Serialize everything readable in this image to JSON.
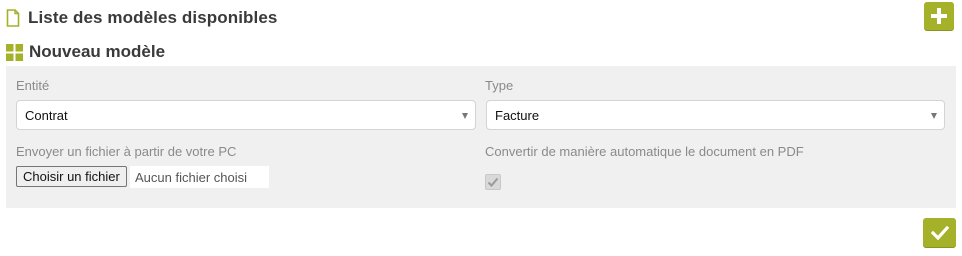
{
  "header": {
    "list_title": "Liste des modèles disponibles",
    "add_button_icon": "plus-icon"
  },
  "section": {
    "title": "Nouveau modèle",
    "icon": "grid-icon"
  },
  "form": {
    "entity": {
      "label": "Entité",
      "value": "Contrat"
    },
    "type": {
      "label": "Type",
      "value": "Facture"
    },
    "upload": {
      "label": "Envoyer un fichier à partir de votre PC",
      "button_label": "Choisir un fichier",
      "status": "Aucun fichier choisi"
    },
    "convert": {
      "label": "Convertir de manière automatique le document en PDF",
      "checked": true,
      "disabled": true
    },
    "submit_icon": "check-icon"
  },
  "colors": {
    "accent": "#a6b12a",
    "panel_bg": "#f0f0f0",
    "title_text": "#3a3a3a",
    "label_text": "#8a8a8a"
  }
}
